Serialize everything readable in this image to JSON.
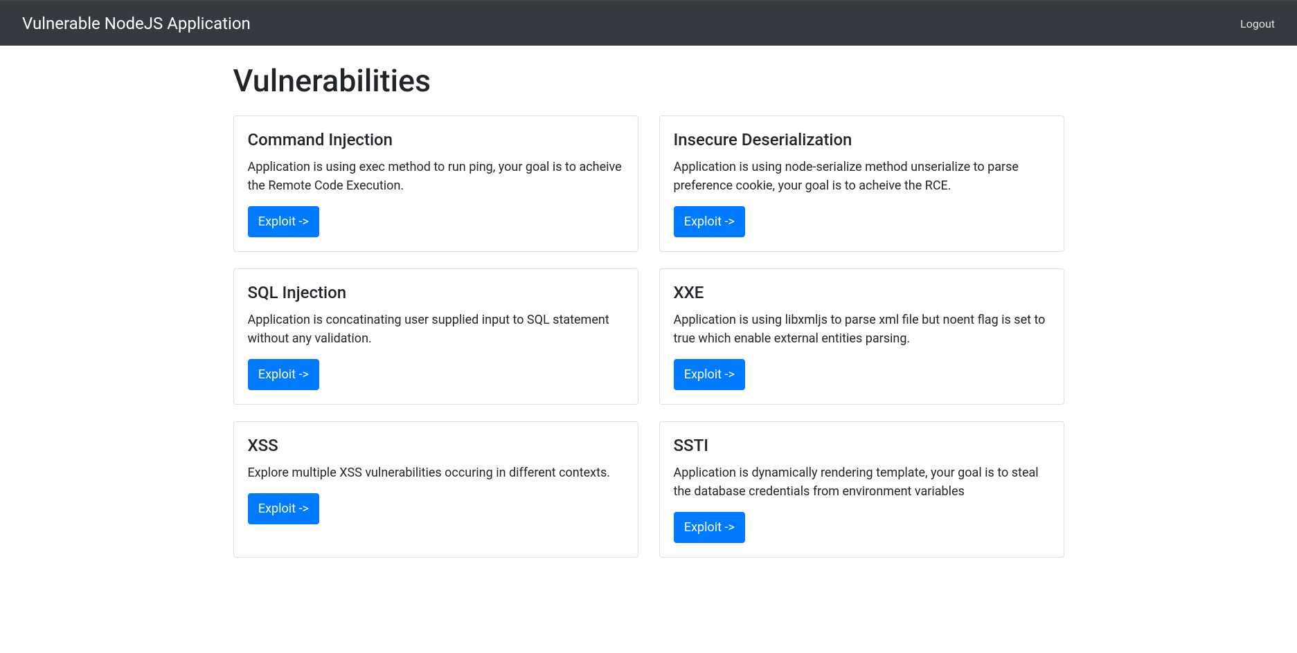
{
  "navbar": {
    "brand": "Vulnerable NodeJS Application",
    "logout": "Logout"
  },
  "page": {
    "title": "Vulnerabilities"
  },
  "cards": [
    {
      "title": "Command Injection",
      "text": "Application is using exec method to run ping, your goal is to acheive the Remote Code Execution.",
      "button": "Exploit ->"
    },
    {
      "title": "Insecure Deserialization",
      "text": "Application is using node-serialize method unserialize to parse preference cookie, your goal is to acheive the RCE.",
      "button": "Exploit ->"
    },
    {
      "title": "SQL Injection",
      "text": "Application is concatinating user supplied input to SQL statement without any validation.",
      "button": "Exploit ->"
    },
    {
      "title": "XXE",
      "text": "Application is using libxmljs to parse xml file but noent flag is set to true which enable external entities parsing.",
      "button": "Exploit ->"
    },
    {
      "title": "XSS",
      "text": "Explore multiple XSS vulnerabilities occuring in different contexts.",
      "button": "Exploit ->"
    },
    {
      "title": "SSTI",
      "text": "Application is dynamically rendering template, your goal is to steal the database credentials from environment variables",
      "button": "Exploit ->"
    }
  ]
}
